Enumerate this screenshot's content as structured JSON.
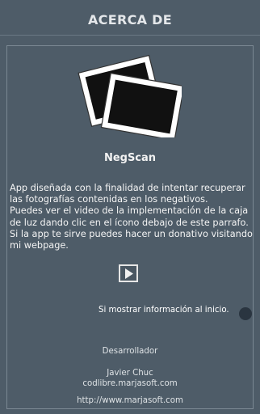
{
  "header": {
    "title": "ACERCA DE"
  },
  "app": {
    "name": "NegScan",
    "logo_icon": "photos-icon"
  },
  "description": [
    "App diseñada con la finalidad de intentar recuperar",
    "las fotografías contenidas en los negativos.",
    "Puedes ver el video de la implementación de la caja",
    "de luz dando clic en el ícono debajo de este parrafo.",
    "Si la app te sirve puedes hacer un donativo visitando",
    "mi webpage."
  ],
  "video_button": {
    "icon": "play-icon"
  },
  "startup_setting": {
    "label": "Si mostrar información al inicio.",
    "checked": false
  },
  "credits": {
    "role": "Desarrollador",
    "author": "Javier Chuc",
    "email": "codlibre.marjasoft.com",
    "website": "http://www.marjasoft.com"
  },
  "colors": {
    "background": "#4e5c68",
    "switch_thumb": "#2a3540",
    "text": "#ffffff"
  }
}
